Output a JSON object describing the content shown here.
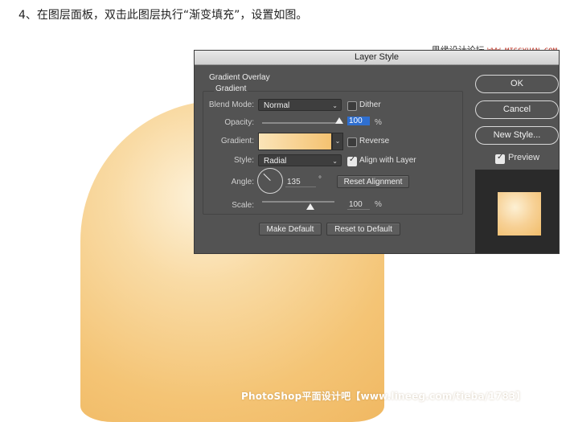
{
  "instruction": "4、在图层面板，双击此图层执行“渐变填充”，设置如图。",
  "site": {
    "name": "思缘设计论坛",
    "domain": "WWW.MISSYUAN.COM"
  },
  "footer_credit": "PhotoShop平面设计吧【www.lineeg.com/tieba/1783】",
  "dialog": {
    "title": "Layer Style",
    "section": "Gradient Overlay",
    "group": "Gradient",
    "blend_mode": {
      "label": "Blend Mode:",
      "value": "Normal"
    },
    "dither": {
      "label": "Dither",
      "checked": false
    },
    "opacity": {
      "label": "Opacity:",
      "value": "100",
      "unit": "%",
      "level": 100
    },
    "gradient": {
      "label": "Gradient:",
      "colors": [
        "#fbe4b8",
        "#f4c271"
      ]
    },
    "reverse": {
      "label": "Reverse",
      "checked": false
    },
    "style": {
      "label": "Style:",
      "value": "Radial"
    },
    "align_with_layer": {
      "label": "Align with Layer",
      "checked": true
    },
    "angle": {
      "label": "Angle:",
      "value": "135",
      "unit": "°"
    },
    "reset_alignment": "Reset Alignment",
    "scale": {
      "label": "Scale:",
      "value": "100",
      "unit": "%",
      "level": 100
    },
    "make_default": "Make Default",
    "reset_to_default": "Reset to Default",
    "side": {
      "ok": "OK",
      "cancel": "Cancel",
      "new_style": "New Style...",
      "preview": {
        "label": "Preview",
        "checked": true
      }
    }
  },
  "colors": {
    "dialog_bg": "#535353",
    "accent": "#2f6fd0",
    "shape_light": "#fdf2da",
    "shape_dark": "#f0b862"
  }
}
